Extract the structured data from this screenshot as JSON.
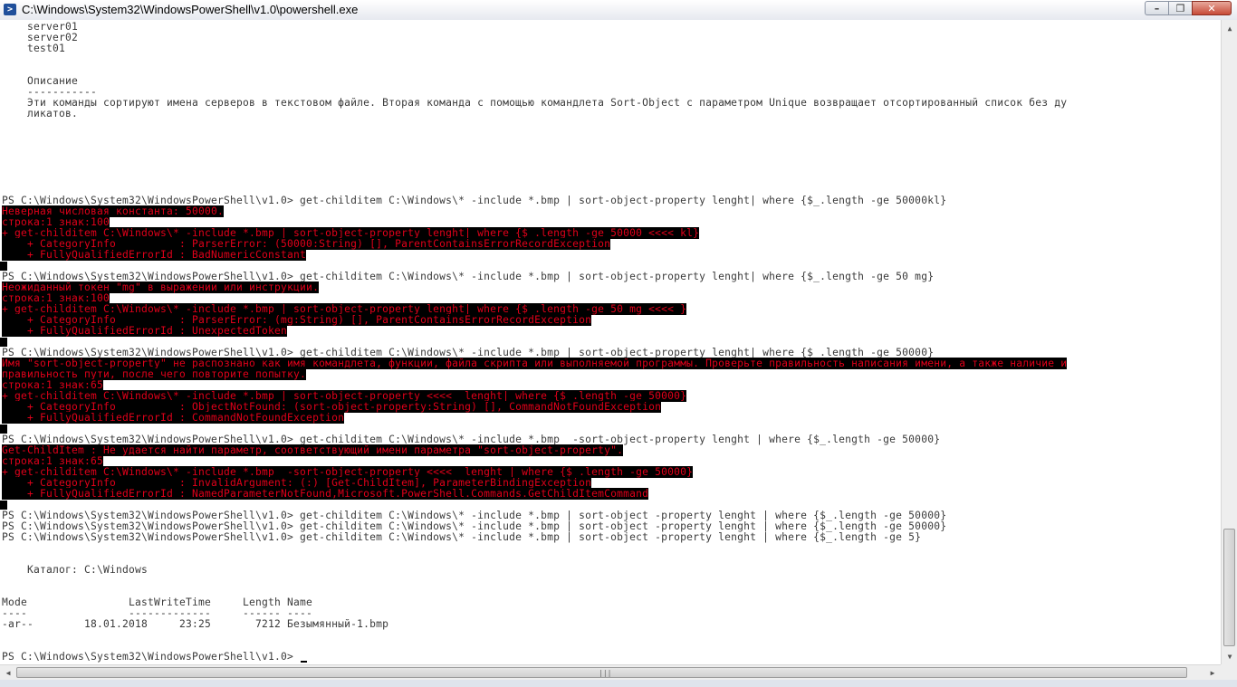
{
  "window": {
    "title": "C:\\Windows\\System32\\WindowsPowerShell\\v1.0\\powershell.exe",
    "icon": "powershell-icon"
  },
  "controls": {
    "minimize": "–",
    "maximize": "❐",
    "close": "✕"
  },
  "colors": {
    "background": "#ffffff",
    "text": "#3a3a3a",
    "error_text": "#e0001a",
    "error_bg": "#000000"
  },
  "console_lines": [
    {
      "text": "    server01",
      "type": "out"
    },
    {
      "text": "    server02",
      "type": "out"
    },
    {
      "text": "    test01",
      "type": "out"
    },
    {
      "text": "",
      "type": "out"
    },
    {
      "text": "",
      "type": "out"
    },
    {
      "text": "    Описание",
      "type": "out"
    },
    {
      "text": "    -----------",
      "type": "out"
    },
    {
      "text": "    Эти команды сортируют имена серверов в текстовом файле. Вторая команда с помощью командлета Sort-Object с параметром Unique возвращает отсортированный список без ду",
      "type": "out"
    },
    {
      "text": "    ликатов.",
      "type": "out"
    },
    {
      "text": "",
      "type": "out"
    },
    {
      "text": "",
      "type": "out"
    },
    {
      "text": "",
      "type": "out"
    },
    {
      "text": "",
      "type": "out"
    },
    {
      "text": "",
      "type": "out"
    },
    {
      "text": "",
      "type": "out"
    },
    {
      "text": "",
      "type": "out"
    },
    {
      "text": "PS C:\\Windows\\System32\\WindowsPowerShell\\v1.0> get-childitem C:\\Windows\\* -include *.bmp | sort-object-property lenght| where {$_.length -ge 50000kl}",
      "type": "out"
    },
    {
      "text": "Неверная числовая константа: 50000.",
      "type": "err"
    },
    {
      "text": "строка:1 знак:100",
      "type": "err"
    },
    {
      "text": "+ get-childitem C:\\Windows\\* -include *.bmp | sort-object-property lenght| where {$_.length -ge 50000 <<<< kl}",
      "type": "err"
    },
    {
      "text": "    + CategoryInfo          : ParserError: (50000:String) [], ParentContainsErrorRecordException",
      "type": "err"
    },
    {
      "text": "    + FullyQualifiedErrorId : BadNumericConstant",
      "type": "err"
    },
    {
      "text": "",
      "type": "errpad"
    },
    {
      "text": "PS C:\\Windows\\System32\\WindowsPowerShell\\v1.0> get-childitem C:\\Windows\\* -include *.bmp | sort-object-property lenght| where {$_.length -ge 50 mg}",
      "type": "out"
    },
    {
      "text": "Неожиданный токен \"mg\" в выражении или инструкции.",
      "type": "err"
    },
    {
      "text": "строка:1 знак:100",
      "type": "err"
    },
    {
      "text": "+ get-childitem C:\\Windows\\* -include *.bmp | sort-object-property lenght| where {$_.length -ge 50 mg <<<< }",
      "type": "err"
    },
    {
      "text": "    + CategoryInfo          : ParserError: (mg:String) [], ParentContainsErrorRecordException",
      "type": "err"
    },
    {
      "text": "    + FullyQualifiedErrorId : UnexpectedToken",
      "type": "err"
    },
    {
      "text": "",
      "type": "errpad"
    },
    {
      "text": "PS C:\\Windows\\System32\\WindowsPowerShell\\v1.0> get-childitem C:\\Windows\\* -include *.bmp | sort-object-property lenght| where {$_.length -ge 50000}",
      "type": "out"
    },
    {
      "text": "Имя \"sort-object-property\" не распознано как имя командлета, функции, файла скрипта или выполняемой программы. Проверьте правильность написания имени, а также наличие и",
      "type": "err"
    },
    {
      "text": "правильность пути, после чего повторите попытку.",
      "type": "err"
    },
    {
      "text": "строка:1 знак:65",
      "type": "err"
    },
    {
      "text": "+ get-childitem C:\\Windows\\* -include *.bmp | sort-object-property <<<<  lenght| where {$_.length -ge 50000}",
      "type": "err"
    },
    {
      "text": "    + CategoryInfo          : ObjectNotFound: (sort-object-property:String) [], CommandNotFoundException",
      "type": "err"
    },
    {
      "text": "    + FullyQualifiedErrorId : CommandNotFoundException",
      "type": "err"
    },
    {
      "text": "",
      "type": "errpad"
    },
    {
      "text": "PS C:\\Windows\\System32\\WindowsPowerShell\\v1.0> get-childitem C:\\Windows\\* -include *.bmp  -sort-object-property lenght | where {$_.length -ge 50000}",
      "type": "out"
    },
    {
      "text": "Get-ChildItem : Не удается найти параметр, соответствующий имени параметра \"sort-object-property\".",
      "type": "err"
    },
    {
      "text": "строка:1 знак:65",
      "type": "err"
    },
    {
      "text": "+ get-childitem C:\\Windows\\* -include *.bmp  -sort-object-property <<<<  lenght | where {$_.length -ge 50000}",
      "type": "err"
    },
    {
      "text": "    + CategoryInfo          : InvalidArgument: (:) [Get-ChildItem], ParameterBindingException",
      "type": "err"
    },
    {
      "text": "    + FullyQualifiedErrorId : NamedParameterNotFound,Microsoft.PowerShell.Commands.GetChildItemCommand",
      "type": "err"
    },
    {
      "text": "",
      "type": "errpad"
    },
    {
      "text": "PS C:\\Windows\\System32\\WindowsPowerShell\\v1.0> get-childitem C:\\Windows\\* -include *.bmp | sort-object -property lenght | where {$_.length -ge 50000}",
      "type": "out"
    },
    {
      "text": "PS C:\\Windows\\System32\\WindowsPowerShell\\v1.0> get-childitem C:\\Windows\\* -include *.bmp | sort-object -property lenght | where {$_.length -ge 50000}",
      "type": "out"
    },
    {
      "text": "PS C:\\Windows\\System32\\WindowsPowerShell\\v1.0> get-childitem C:\\Windows\\* -include *.bmp | sort-object -property lenght | where {$_.length -ge 5}",
      "type": "out"
    },
    {
      "text": "",
      "type": "out"
    },
    {
      "text": "",
      "type": "out"
    },
    {
      "text": "    Каталог: C:\\Windows",
      "type": "out"
    },
    {
      "text": "",
      "type": "out"
    },
    {
      "text": "",
      "type": "out"
    },
    {
      "text": "Mode                LastWriteTime     Length Name",
      "type": "out"
    },
    {
      "text": "----                -------------     ------ ----",
      "type": "out"
    },
    {
      "text": "-ar--        18.01.2018     23:25       7212 Безымянный-1.bmp",
      "type": "out"
    },
    {
      "text": "",
      "type": "out"
    },
    {
      "text": "",
      "type": "out"
    },
    {
      "text": "PS C:\\Windows\\System32\\WindowsPowerShell\\v1.0> ",
      "type": "prompt"
    }
  ]
}
